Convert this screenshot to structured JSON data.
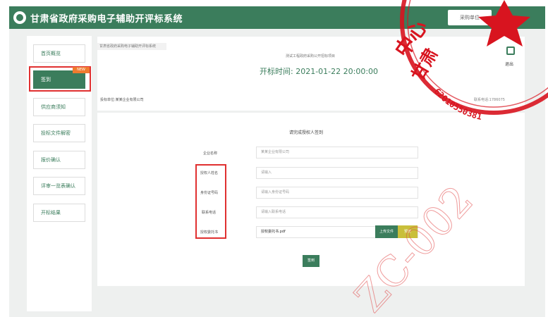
{
  "header": {
    "title": "甘肃省政府采购电子辅助开评标系统",
    "user_button": "采购单位"
  },
  "sidebar": {
    "items": [
      {
        "label": "首页概览"
      },
      {
        "label": "签到"
      },
      {
        "label": "供应商须知"
      },
      {
        "label": "投标文件解密"
      },
      {
        "label": "报价确认"
      },
      {
        "label": "评审一览表确认"
      },
      {
        "label": "开标结果"
      }
    ],
    "badge": "NEW"
  },
  "main": {
    "breadcrumb": "甘肃省政府采购电子辅助开评标系统",
    "project_name": "测试工程政府采购公开招标项目",
    "open_time_label": "开标时间:",
    "open_time_value": "2021-01-22 20:00:00",
    "exit_label": "退出",
    "info_left": "投标单位:某某企业有限公司",
    "info_right": "联系电话:1786075"
  },
  "form": {
    "title": "请完成授权人签到",
    "labels": {
      "company": "企业名称",
      "agent_name": "授权人姓名",
      "id_number": "身份证号码",
      "phone": "联系电话",
      "auth_letter": "授权委托书"
    },
    "fields": {
      "company": "某某企业有限公司",
      "agent_name": "请输入",
      "id_number": "请输入身份证号码",
      "phone": "请输入联系电话",
      "auth_letter_file": "授权委托书.pdf"
    },
    "upload_button": "上传文件",
    "preview_button": "预览",
    "submit_button": "签到"
  },
  "seal": {
    "code": "62010550381",
    "center_text": "中心",
    "side_text": "甘肃"
  },
  "watermark": "ZC-002",
  "colors": {
    "brand_green": "#3b7d5c",
    "highlight_red": "#e03030",
    "preview_yellow": "#c9bf3a",
    "seal_red": "#d8141f"
  }
}
